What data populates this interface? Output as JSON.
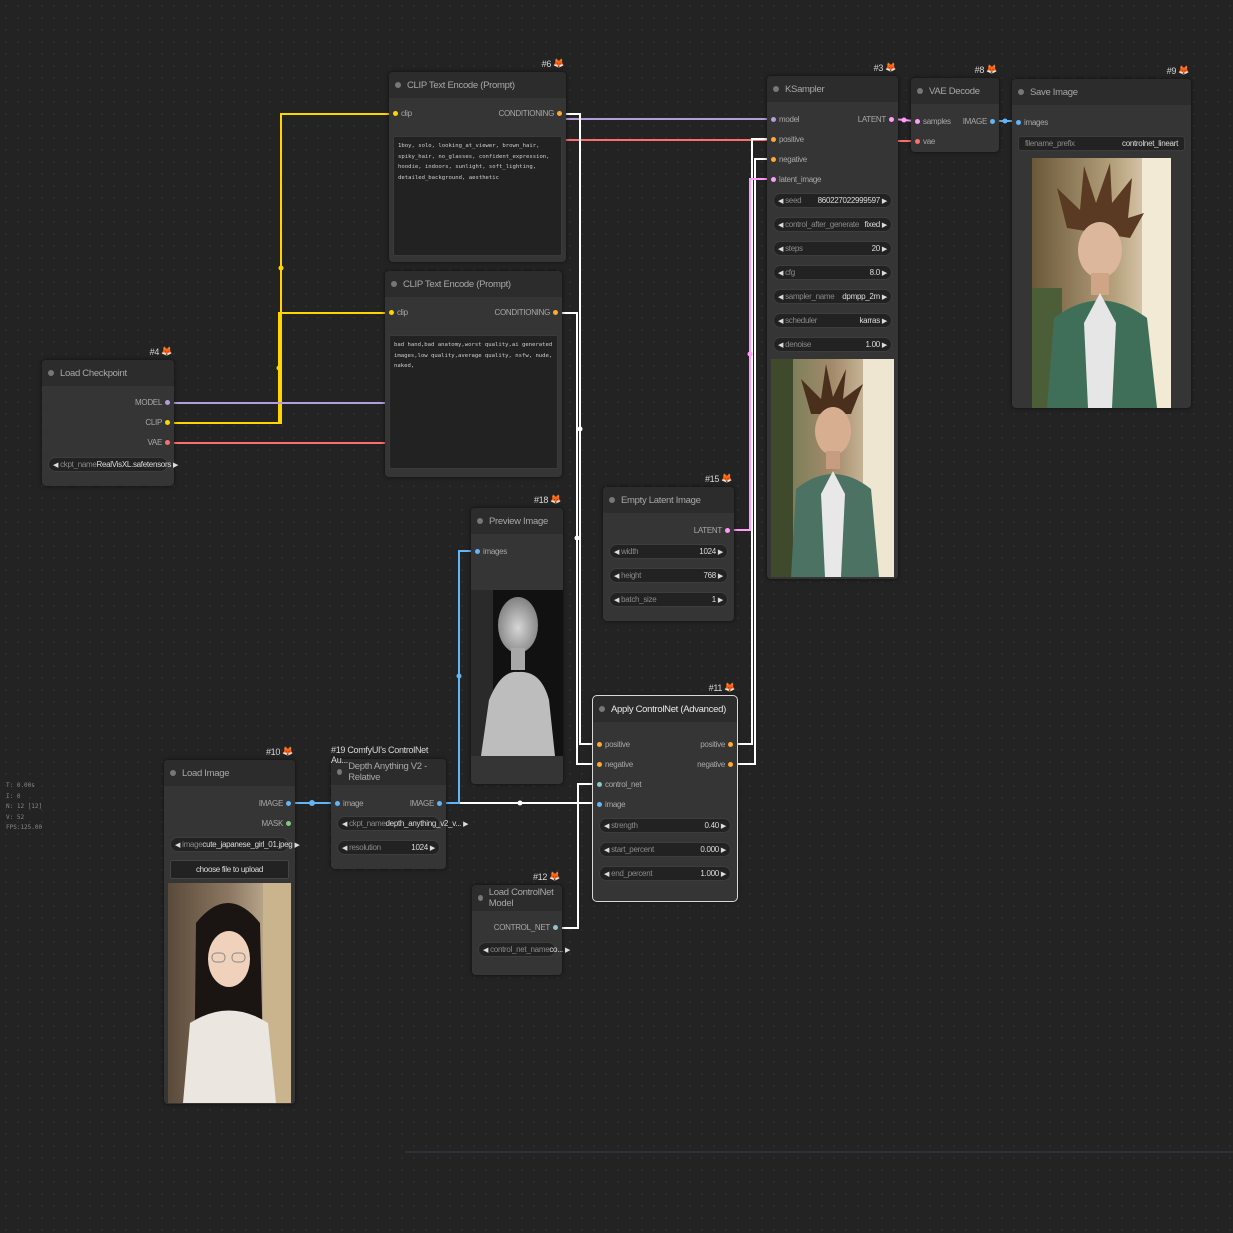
{
  "stats": [
    "T: 0.00s",
    "I: 0",
    "N: 12 [12]",
    "V: 52",
    "FPS:125.00"
  ],
  "nodes": {
    "clip_pos": {
      "id": "#6",
      "title": "CLIP Text Encode (Prompt)",
      "in": "clip",
      "out": "CONDITIONING",
      "text": "1boy, solo, looking_at_viewer, brown_hair, spiky_hair, no_glasses, confident_expression, hoodie, indoors, sunlight, soft_lighting, detailed_background, aesthetic"
    },
    "clip_neg": {
      "id": "",
      "title": "CLIP Text Encode (Prompt)",
      "in": "clip",
      "out": "CONDITIONING",
      "text": "bad hand,bad anatomy,worst quality,ai generated images,low quality,average quality, nsfw, nude, naked,"
    },
    "checkpoint": {
      "id": "#4",
      "title": "Load Checkpoint",
      "outs": [
        "MODEL",
        "CLIP",
        "VAE"
      ],
      "ckpt_label": "ckpt_name",
      "ckpt_value": "RealVisXL.safetensors"
    },
    "ksampler": {
      "id": "#3",
      "title": "KSampler",
      "ins": [
        "model",
        "positive",
        "negative",
        "latent_image"
      ],
      "out": "LATENT",
      "widgets": [
        {
          "label": "seed",
          "value": "860227022999597"
        },
        {
          "label": "control_after_generate",
          "value": "fixed"
        },
        {
          "label": "steps",
          "value": "20"
        },
        {
          "label": "cfg",
          "value": "8.0"
        },
        {
          "label": "sampler_name",
          "value": "dpmpp_2m"
        },
        {
          "label": "scheduler",
          "value": "karras"
        },
        {
          "label": "denoise",
          "value": "1.00"
        }
      ]
    },
    "vae_decode": {
      "id": "#8",
      "title": "VAE Decode",
      "ins": [
        "samples",
        "vae"
      ],
      "out": "IMAGE"
    },
    "save_image": {
      "id": "#9",
      "title": "Save Image",
      "in": "images",
      "prefix_label": "filename_prefix",
      "prefix_value": "controlnet_lineart"
    },
    "preview": {
      "id": "#18",
      "title": "Preview Image",
      "in": "images"
    },
    "empty_latent": {
      "id": "#15",
      "title": "Empty Latent Image",
      "out": "LATENT",
      "widgets": [
        {
          "label": "width",
          "value": "1024"
        },
        {
          "label": "height",
          "value": "768"
        },
        {
          "label": "batch_size",
          "value": "1"
        }
      ]
    },
    "apply_cn": {
      "id": "#11",
      "title": "Apply ControlNet (Advanced)",
      "ins": [
        "positive",
        "negative",
        "control_net",
        "image"
      ],
      "outs": [
        "positive",
        "negative"
      ],
      "widgets": [
        {
          "label": "strength",
          "value": "0.40"
        },
        {
          "label": "start_percent",
          "value": "0.000"
        },
        {
          "label": "end_percent",
          "value": "1.000"
        }
      ]
    },
    "load_image": {
      "id": "#10",
      "title": "Load Image",
      "outs": [
        "IMAGE",
        "MASK"
      ],
      "image_label": "image",
      "image_value": "cute_japanese_girl_01.jpeg",
      "upload": "choose file to upload"
    },
    "depth": {
      "id": "#19 ComfyUI's ControlNet Au...",
      "title": "Depth Anything V2 - Relative",
      "in": "image",
      "out": "IMAGE",
      "widgets": [
        {
          "label": "ckpt_name",
          "value": "depth_anything_v2_v..."
        },
        {
          "label": "resolution",
          "value": "1024"
        }
      ]
    },
    "cn_loader": {
      "id": "#12",
      "title": "Load ControlNet Model",
      "out": "CONTROL_NET",
      "widget_label": "control_net_name",
      "widget_value": "co..."
    }
  },
  "colors": {
    "model": "#b39ddb",
    "clip": "#ffd500",
    "vae": "#ff6e6e",
    "conditioning": "#ffa931",
    "latent": "#ff9cf9",
    "image": "#64b5f6",
    "control_net": "#ffffff",
    "mask": "#81c784",
    "accent": "#f39c12"
  }
}
